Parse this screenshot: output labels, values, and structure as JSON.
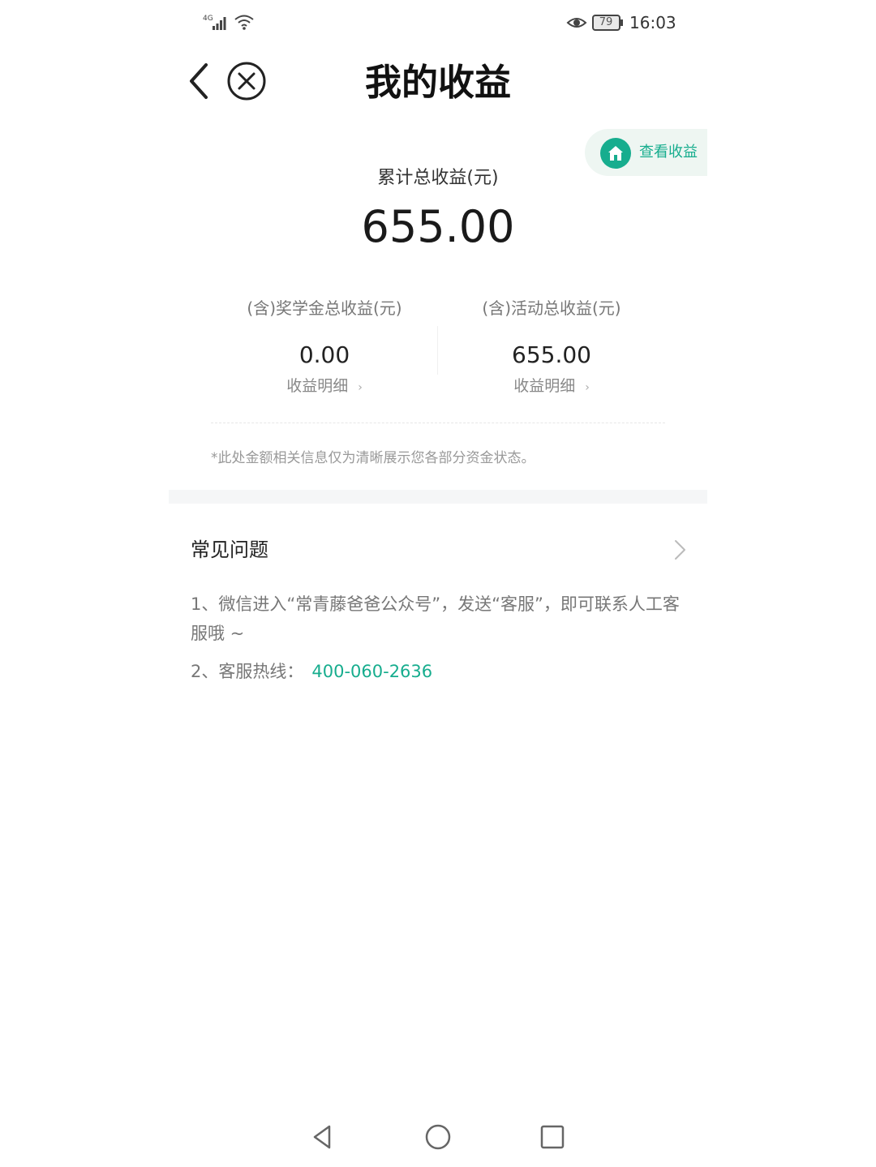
{
  "status_bar": {
    "network": "4G",
    "battery": "79",
    "time": "16:03"
  },
  "header": {
    "title": "我的收益"
  },
  "view_earnings": {
    "label": "查看收益",
    "icon": "home-icon",
    "accent": "#17ad8e"
  },
  "summary": {
    "total_label": "累计总收益(元)",
    "total_value": "655.00",
    "scholarship": {
      "label": "(含)奖学金总收益(元)",
      "value": "0.00",
      "link": "收益明细"
    },
    "activity": {
      "label": "(含)活动总收益(元)",
      "value": "655.00",
      "link": "收益明细"
    },
    "disclaimer": "*此处金额相关信息仅为清晰展示您各部分资金状态。"
  },
  "faq": {
    "title": "常见问题",
    "item1": "1、微信进入“常青藤爸爸公众号”，发送“客服”，即可联系人工客服哦 ~",
    "item2_prefix": "2、客服热线：",
    "hotline": "400-060-2636"
  },
  "colors": {
    "accent": "#17ad8e",
    "pill_background": "#eef6f2"
  }
}
